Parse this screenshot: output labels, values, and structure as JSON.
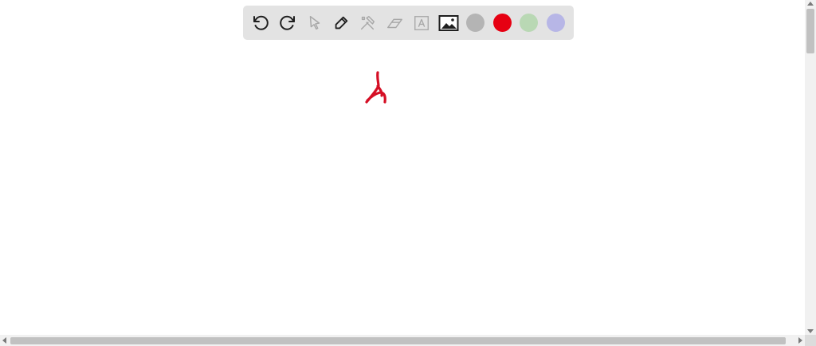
{
  "toolbar": {
    "tools": [
      {
        "name": "undo-icon",
        "enabled": true
      },
      {
        "name": "redo-icon",
        "enabled": true
      },
      {
        "name": "pointer-icon",
        "enabled": false
      },
      {
        "name": "pen-icon",
        "enabled": true
      },
      {
        "name": "tools-icon",
        "enabled": false
      },
      {
        "name": "eraser-icon",
        "enabled": false
      },
      {
        "name": "text-icon",
        "enabled": false
      },
      {
        "name": "image-icon",
        "enabled": true
      }
    ],
    "colors": [
      "#b4b4b4",
      "#e60012",
      "#b9d8b4",
      "#b7b6e6"
    ],
    "icon_color_enabled": "#1f1f1f",
    "icon_color_disabled": "#a8a8a8"
  },
  "canvas": {
    "stroke_color": "#d50f25"
  }
}
